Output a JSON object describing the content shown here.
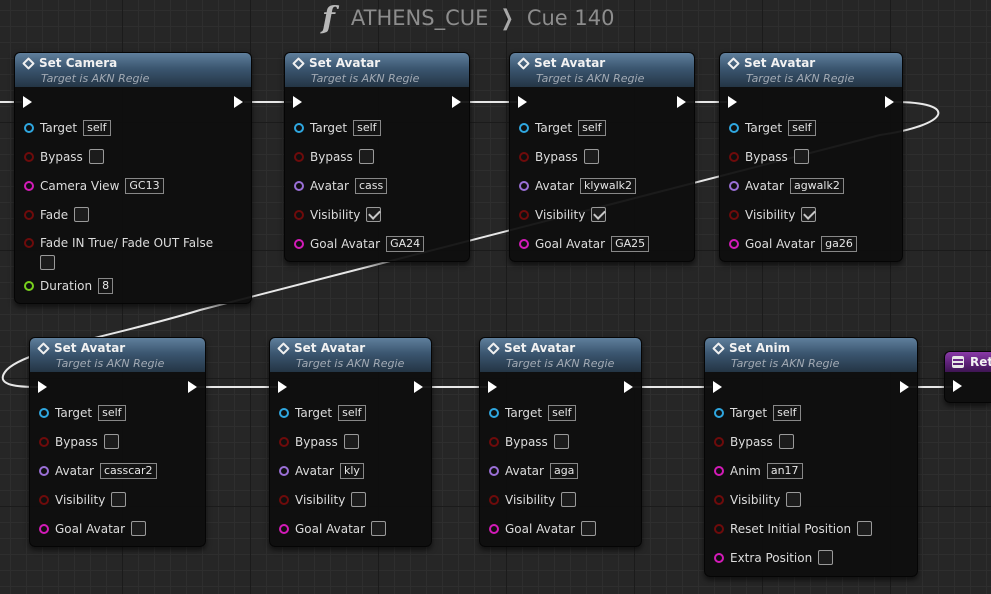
{
  "breadcrumb": {
    "graph": "ATHENS_CUE",
    "separator": "❯",
    "function": "Cue 140",
    "icon": "function-icon"
  },
  "colors": {
    "header_blue": "#3b5670",
    "header_purple": "#5e2279",
    "pin_target": "#2fa7e0",
    "pin_bool": "#6e0b0b",
    "pin_string": "#d31bb8",
    "pin_object": "#9a6fd6",
    "pin_float": "#79d11d",
    "wire_exec": "#ffffff"
  },
  "nodes": {
    "n1": {
      "title": "Set Camera",
      "subtitle": "Target is AKN Regie",
      "target_label": "Target",
      "target_value": "self",
      "bypass_label": "Bypass",
      "bypass_checked": false,
      "camera_view_label": "Camera View",
      "camera_view_value": "GC13",
      "fade_label": "Fade",
      "fade_checked": false,
      "fade_in_label": "Fade IN True/ Fade OUT False",
      "fade_in_checked": false,
      "duration_label": "Duration",
      "duration_value": "8"
    },
    "n2": {
      "title": "Set Avatar",
      "subtitle": "Target is AKN Regie",
      "target_label": "Target",
      "target_value": "self",
      "bypass_label": "Bypass",
      "bypass_checked": false,
      "avatar_label": "Avatar",
      "avatar_value": "cass",
      "visibility_label": "Visibility",
      "visibility_checked": true,
      "goal_label": "Goal Avatar",
      "goal_value": "GA24"
    },
    "n3": {
      "title": "Set Avatar",
      "subtitle": "Target is AKN Regie",
      "target_label": "Target",
      "target_value": "self",
      "bypass_label": "Bypass",
      "bypass_checked": false,
      "avatar_label": "Avatar",
      "avatar_value": "klywalk2",
      "visibility_label": "Visibility",
      "visibility_checked": true,
      "goal_label": "Goal Avatar",
      "goal_value": "GA25"
    },
    "n4": {
      "title": "Set Avatar",
      "subtitle": "Target is AKN Regie",
      "target_label": "Target",
      "target_value": "self",
      "bypass_label": "Bypass",
      "bypass_checked": false,
      "avatar_label": "Avatar",
      "avatar_value": "agwalk2",
      "visibility_label": "Visibility",
      "visibility_checked": true,
      "goal_label": "Goal Avatar",
      "goal_value": "ga26"
    },
    "n5": {
      "title": "Set Avatar",
      "subtitle": "Target is AKN Regie",
      "target_label": "Target",
      "target_value": "self",
      "bypass_label": "Bypass",
      "bypass_checked": false,
      "avatar_label": "Avatar",
      "avatar_value": "casscar2",
      "visibility_label": "Visibility",
      "visibility_checked": false,
      "goal_label": "Goal Avatar",
      "goal_value": ""
    },
    "n6": {
      "title": "Set Avatar",
      "subtitle": "Target is AKN Regie",
      "target_label": "Target",
      "target_value": "self",
      "bypass_label": "Bypass",
      "bypass_checked": false,
      "avatar_label": "Avatar",
      "avatar_value": "kly",
      "visibility_label": "Visibility",
      "visibility_checked": false,
      "goal_label": "Goal Avatar",
      "goal_value": ""
    },
    "n7": {
      "title": "Set Avatar",
      "subtitle": "Target is AKN Regie",
      "target_label": "Target",
      "target_value": "self",
      "bypass_label": "Bypass",
      "bypass_checked": false,
      "avatar_label": "Avatar",
      "avatar_value": "aga",
      "visibility_label": "Visibility",
      "visibility_checked": false,
      "goal_label": "Goal Avatar",
      "goal_value": ""
    },
    "n8": {
      "title": "Set Anim",
      "subtitle": "Target is AKN Regie",
      "target_label": "Target",
      "target_value": "self",
      "bypass_label": "Bypass",
      "bypass_checked": false,
      "anim_label": "Anim",
      "anim_value": "an17",
      "visibility_label": "Visibility",
      "visibility_checked": false,
      "reset_label": "Reset Initial Position",
      "reset_checked": false,
      "extra_label": "Extra Position",
      "extra_checked": false
    },
    "n9": {
      "title": "Ret"
    }
  }
}
